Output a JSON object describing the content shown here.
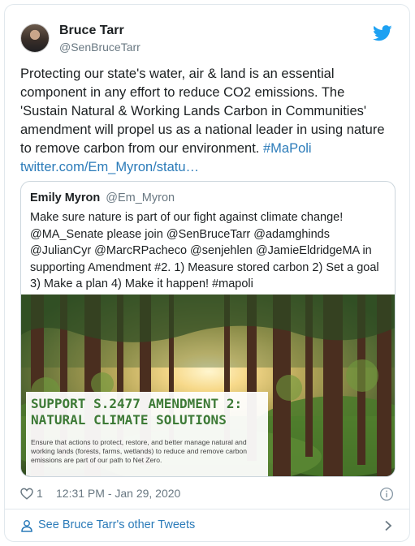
{
  "author": {
    "display_name": "Bruce Tarr",
    "handle": "@SenBruceTarr"
  },
  "tweet": {
    "text_before": "Protecting our state's water, air & land is an essential component in any effort to reduce CO2 emissions. The 'Sustain Natural & Working Lands Carbon in Communities' amendment will propel us as a national leader in using nature to remove carbon from our environment. ",
    "hashtag": "#MaPoli",
    "link": "twitter.com/Em_Myron/statu…"
  },
  "quoted": {
    "display_name": "Emily Myron",
    "handle": "@Em_Myron",
    "text": "Make sure nature is part of our fight against climate change! @MA_Senate please join @SenBruceTarr @adamghinds @JulianCyr @MarcRPacheco @senjehlen @JamieEldridgeMA in supporting Amendment #2. 1) Measure stored carbon 2) Set a goal 3) Make a plan 4) Make it happen! #mapoli",
    "image": {
      "title": "SUPPORT S.2477 AMENDMENT 2: NATURAL CLIMATE SOLUTIONS",
      "subtitle": "Ensure that actions to protect, restore, and better manage natural and working lands (forests, farms, wetlands) to reduce and remove carbon emissions are part of our path to Net Zero."
    }
  },
  "meta": {
    "likes": "1",
    "timestamp": "12:31 PM - Jan 29, 2020"
  },
  "footer": {
    "link_text": "See Bruce Tarr's other Tweets"
  },
  "colors": {
    "link": "#2b7bb9",
    "twitter_blue": "#1da1f2",
    "secondary_text": "#697882",
    "border": "#e1e8ed",
    "banner_green": "#3d7a36"
  },
  "icons": [
    "twitter-bird-icon",
    "heart-icon",
    "info-icon",
    "person-icon",
    "chevron-right-icon"
  ]
}
